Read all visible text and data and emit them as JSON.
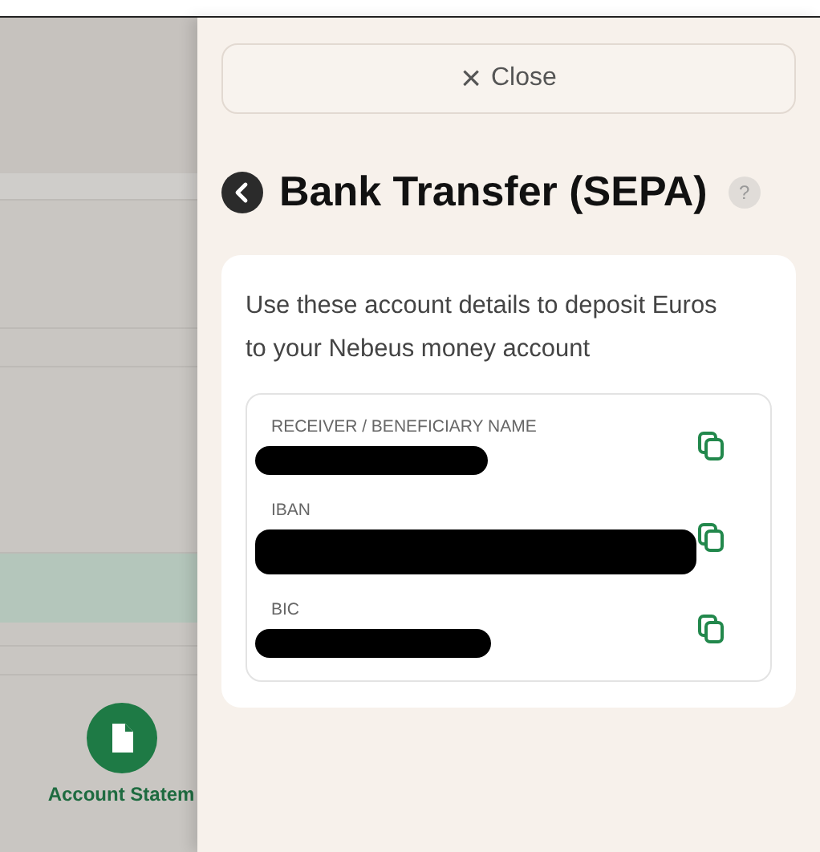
{
  "background": {
    "shortcut": {
      "label": "Account Statem"
    }
  },
  "panel": {
    "close_button": {
      "icon": "×",
      "label": "Close"
    },
    "title": "Bank Transfer (SEPA)",
    "help": "?",
    "description": "Use these account details to deposit Euros to your Nebeus money account",
    "fields": [
      {
        "label": "RECEIVER / BENEFICIARY NAME",
        "redacted": true
      },
      {
        "label": "IBAN",
        "redacted": true
      },
      {
        "label": "BIC",
        "redacted": true
      }
    ]
  }
}
